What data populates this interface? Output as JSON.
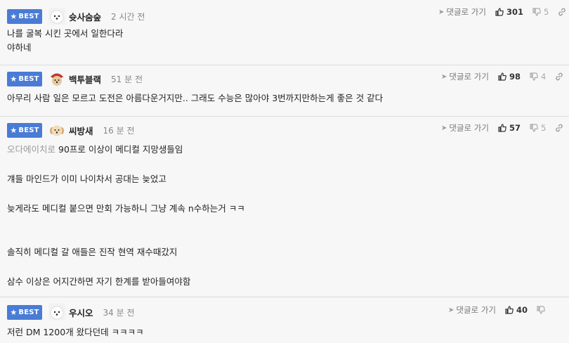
{
  "badge_label": "BEST",
  "reply_label": "댓글로 가기",
  "comments": [
    {
      "nick": "슛사숨숲",
      "time": "2 시간 전",
      "likes": "301",
      "dislikes": "5",
      "lines": [
        "나를 굴복 시킨 곳에서 일한다라",
        "야하네"
      ]
    },
    {
      "nick": "백투블랙",
      "time": "51 분 전",
      "likes": "98",
      "dislikes": "4",
      "lines": [
        "아무리 사람 일은 모르고 도전은 아름다운거지만.. 그래도 수능은 많아야 3번까지만하는게 좋은 것 같다"
      ]
    },
    {
      "nick": "씨방새",
      "time": "16 분 전",
      "likes": "57",
      "dislikes": "5",
      "mention": "오다에이치로",
      "lines": [
        "90프로 이상이 메디컬 지망생들임",
        "걔들 마인드가 이미 나이차서 공대는 늦었고",
        "늦게라도 메디컬 붙으면 만회 가능하니 그냥 계속 n수하는거 ㅋㅋ",
        "솔직히 메디컬 갈 애들은 진작 현역 재수때갔지",
        "삼수 이상은 어지간하면 자기 한계를 받아들여야함"
      ]
    },
    {
      "nick": "우시오",
      "time": "34 분 전",
      "likes": "40",
      "dislikes": "",
      "lines": [
        "저런 DM 1200개 왔다던데 ㅋㅋㅋㅋ"
      ]
    }
  ]
}
